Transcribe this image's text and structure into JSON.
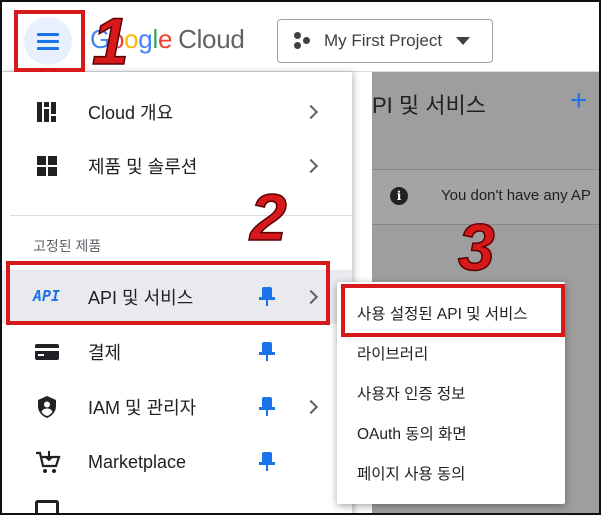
{
  "header": {
    "logo_google": [
      "G",
      "o",
      "o",
      "g",
      "l",
      "e"
    ],
    "logo_cloud": "Cloud",
    "project_name": "My First Project"
  },
  "annotations": {
    "step1": "1",
    "step2": "2",
    "step3": "3",
    "color": "#d7191c"
  },
  "sidenav": {
    "items_top": [
      {
        "label": "Cloud 개요",
        "icon": "dashboard-icon"
      },
      {
        "label": "제품 및 솔루션",
        "icon": "grid-icon"
      }
    ],
    "section_label": "고정된 제품",
    "pinned": [
      {
        "label": "API 및 서비스",
        "icon_text": "API",
        "icon": "api-icon"
      },
      {
        "label": "결제",
        "icon": "billing-card-icon"
      },
      {
        "label": "IAM 및 관리자",
        "icon": "shield-icon"
      },
      {
        "label": "Marketplace",
        "icon": "cart-icon"
      }
    ]
  },
  "submenu": {
    "items": [
      "사용 설정된 API 및 서비스",
      "라이브러리",
      "사용자 인증 정보",
      "OAuth 동의 화면",
      "페이지 사용 동의"
    ]
  },
  "content": {
    "title": "PI 및 서비스",
    "plus": "+",
    "notice": "You don't have any AP"
  },
  "colors": {
    "accent": "#1a73e8",
    "active_bg": "#e8f0fe",
    "overlay": "#9e9e9e"
  }
}
